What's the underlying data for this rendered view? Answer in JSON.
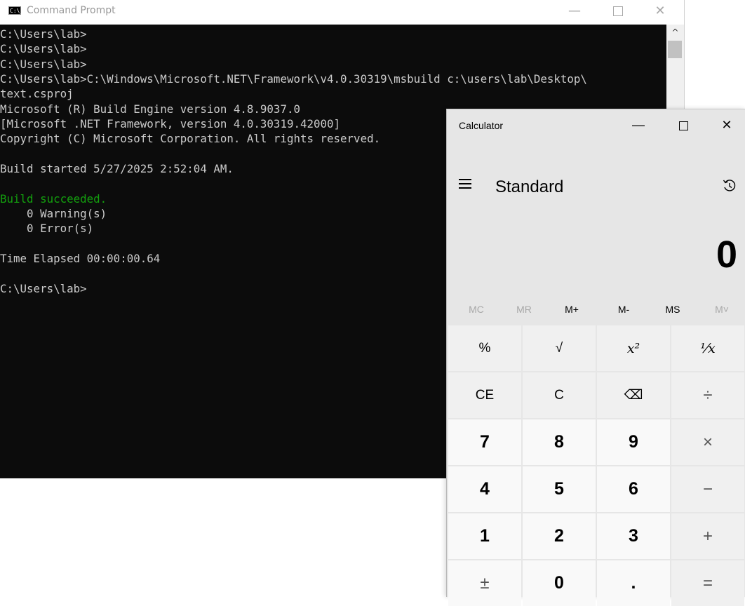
{
  "cmd": {
    "title": "Command Prompt",
    "icon": "cmd-icon",
    "icon_text": "C:\\_",
    "controls": {
      "minimize": "—",
      "close": "✕"
    },
    "lines": [
      {
        "text": "C:\\Users\\lab>",
        "color": "#cccccc"
      },
      {
        "text": "C:\\Users\\lab>",
        "color": "#cccccc"
      },
      {
        "text": "C:\\Users\\lab>",
        "color": "#cccccc"
      },
      {
        "text": "C:\\Users\\lab>C:\\Windows\\Microsoft.NET\\Framework\\v4.0.30319\\msbuild c:\\users\\lab\\Desktop\\",
        "color": "#cccccc"
      },
      {
        "text": "text.csproj",
        "color": "#cccccc"
      },
      {
        "text": "Microsoft (R) Build Engine version 4.8.9037.0",
        "color": "#cccccc"
      },
      {
        "text": "[Microsoft .NET Framework, version 4.0.30319.42000]",
        "color": "#cccccc"
      },
      {
        "text": "Copyright (C) Microsoft Corporation. All rights reserved.",
        "color": "#cccccc"
      },
      {
        "text": "",
        "color": "#cccccc"
      },
      {
        "text": "Build started 5/27/2025 2:52:04 AM.",
        "color": "#cccccc"
      },
      {
        "text": "",
        "color": "#cccccc"
      },
      {
        "text": "Build succeeded.",
        "color": "#13a10e"
      },
      {
        "text": "    0 Warning(s)",
        "color": "#cccccc"
      },
      {
        "text": "    0 Error(s)",
        "color": "#cccccc"
      },
      {
        "text": "",
        "color": "#cccccc"
      },
      {
        "text": "Time Elapsed 00:00:00.64",
        "color": "#cccccc"
      },
      {
        "text": "",
        "color": "#cccccc"
      },
      {
        "text": "C:\\Users\\lab>",
        "color": "#cccccc"
      }
    ],
    "scroll_up": "^"
  },
  "calc": {
    "title": "Calculator",
    "controls": {
      "minimize": "—",
      "close": "✕"
    },
    "mode": "Standard",
    "display": "0",
    "memory": [
      {
        "label": "MC",
        "enabled": false
      },
      {
        "label": "MR",
        "enabled": false
      },
      {
        "label": "M+",
        "enabled": true
      },
      {
        "label": "M-",
        "enabled": true
      },
      {
        "label": "MS",
        "enabled": true
      },
      {
        "label": "M˅",
        "enabled": false
      }
    ],
    "keys": {
      "percent": "%",
      "sqrt": "√",
      "square": "x²",
      "reciprocal": "¹⁄x",
      "ce": "CE",
      "c": "C",
      "backspace": "⌫",
      "divide": "÷",
      "seven": "7",
      "eight": "8",
      "nine": "9",
      "multiply": "×",
      "four": "4",
      "five": "5",
      "six": "6",
      "minus": "−",
      "one": "1",
      "two": "2",
      "three": "3",
      "plus": "+",
      "negate": "±",
      "zero": "0",
      "decimal": ".",
      "equals": "="
    }
  }
}
